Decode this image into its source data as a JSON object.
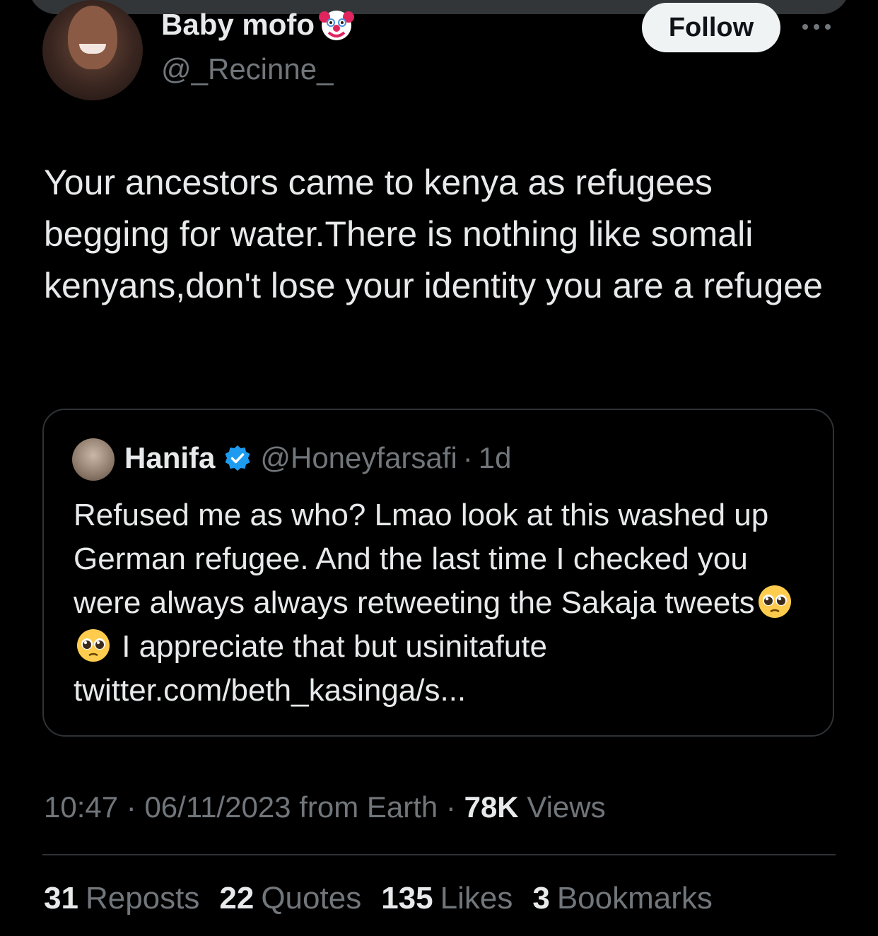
{
  "author": {
    "display_name": "Baby mofo",
    "handle": "@_Recinne_",
    "name_emoji": "clown-face"
  },
  "follow_button": {
    "label": "Follow"
  },
  "tweet": {
    "text": "Your ancestors came to kenya as refugees begging for water.There is nothing like somali kenyans,don't lose your identity you are a refugee"
  },
  "quoted_tweet": {
    "name": "Hanifa",
    "handle": "@Honeyfarsafi",
    "separator": "·",
    "time": "1d",
    "text_part1": "Refused me as who? Lmao look at this washed up German refugee. And the last time I checked you were always always retweeting the Sakaja tweets",
    "text_part2": " I appreciate that but usinitafute twitter.com/beth_kasinga/s...",
    "emoji": "pleading-face"
  },
  "meta": {
    "time": "10:47",
    "sep1": " · ",
    "date": "06/11/2023",
    "source": " from Earth",
    "sep2": " · ",
    "views_count": "78K",
    "views_label": " Views"
  },
  "stats": {
    "reposts_count": "31",
    "reposts_label": "Reposts",
    "quotes_count": "22",
    "quotes_label": "Quotes",
    "likes_count": "135",
    "likes_label": "Likes",
    "bookmarks_count": "3",
    "bookmarks_label": "Bookmarks"
  },
  "colors": {
    "background": "#000000",
    "primary_text": "#e7e9ea",
    "secondary_text": "#71767b",
    "border": "#2f3336",
    "verified": "#1d9bf0"
  }
}
